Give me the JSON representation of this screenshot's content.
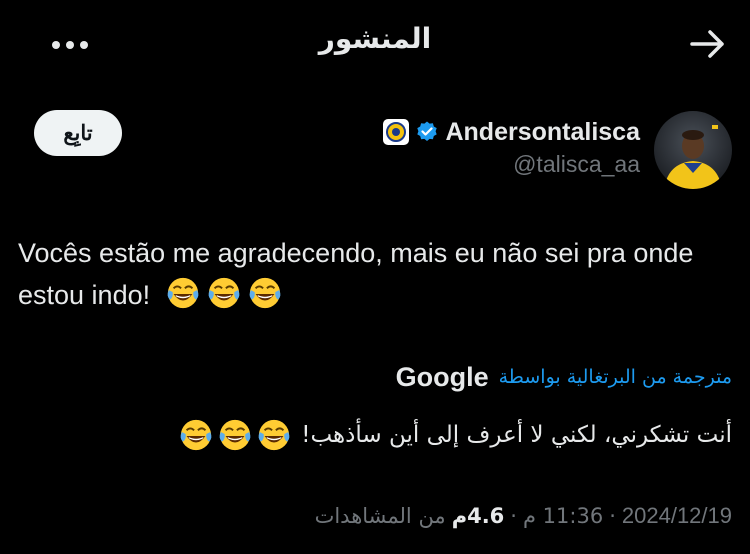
{
  "header": {
    "title": "المنشور",
    "more_icon": "more-horizontal-icon",
    "forward_icon": "arrow-right-icon"
  },
  "author": {
    "display_name": "Andersontalisca",
    "handle": "@talisca_aa",
    "verified_icon": "verified-badge-icon",
    "affiliation_icon": "al-nassr-badge-icon",
    "follow_label": "تابِع"
  },
  "tweet": {
    "text": "Vocês estão me agradecendo, mais eu não sei pra onde estou indo!",
    "emoji_count": 3
  },
  "translation": {
    "label": "مترجمة من البرتغالية بواسطة",
    "provider": "Google",
    "text": "أنت تشكرني، لكني لا أعرف إلى أين سأذهب!"
  },
  "meta": {
    "date": "2024/12/19",
    "time": "11:36 م",
    "views_count": "4.6م",
    "views_label": "من المشاهدات"
  },
  "colors": {
    "background": "#000000",
    "text": "#e7e9ea",
    "muted": "#71767b",
    "link": "#1d9bf0",
    "emoji": "#ffcc33"
  }
}
